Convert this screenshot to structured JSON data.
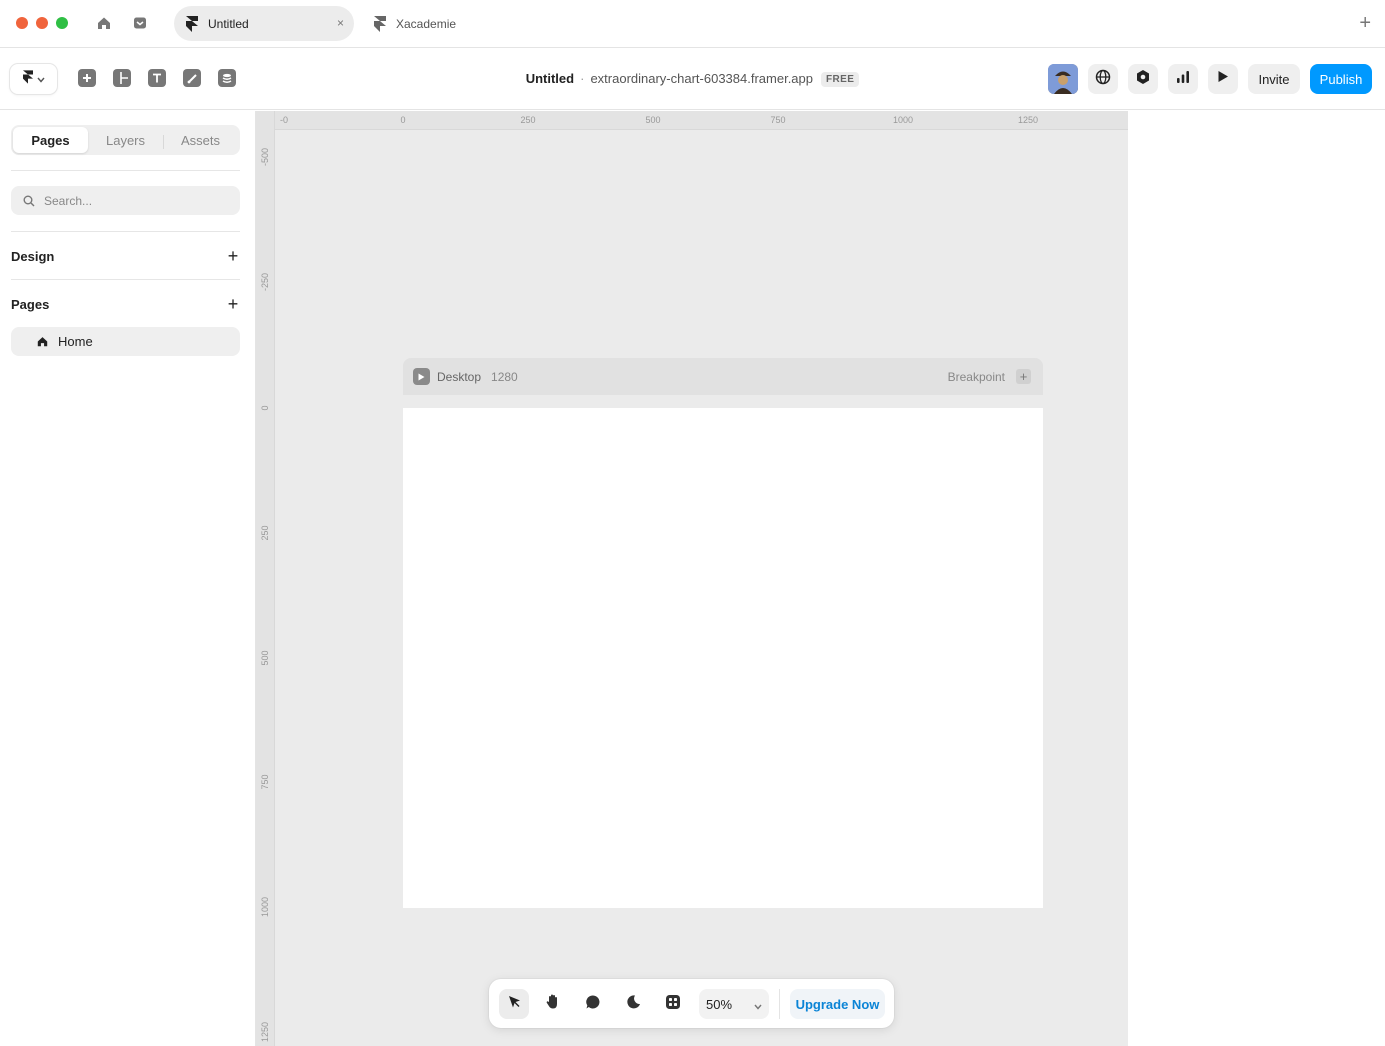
{
  "browser": {
    "tabs": [
      {
        "label": "Untitled",
        "close": "×"
      },
      {
        "label": "Xacademie"
      }
    ],
    "new_tab": "+"
  },
  "toolbar": {
    "project_name": "Untitled",
    "separator": "·",
    "project_url": "extraordinary-chart-603384.framer.app",
    "plan_badge": "FREE",
    "invite_label": "Invite",
    "publish_label": "Publish",
    "insert_tools": [
      "plus-square-icon",
      "layout-icon",
      "text-icon",
      "pen-icon",
      "database-icon"
    ]
  },
  "sidebar": {
    "tabs": [
      "Pages",
      "Layers",
      "Assets"
    ],
    "active_tab": "Pages",
    "search_placeholder": "Search...",
    "sections": [
      {
        "title": "Design",
        "add": "+"
      },
      {
        "title": "Pages",
        "add": "+"
      }
    ],
    "pages": [
      {
        "label": "Home",
        "icon": "home-icon"
      }
    ]
  },
  "canvas": {
    "ruler_top": [
      "-0",
      "0",
      "250",
      "500",
      "750",
      "1000",
      "1250"
    ],
    "ruler_left": [
      "-500",
      "-250",
      "0",
      "250",
      "500",
      "750",
      "1000",
      "1250"
    ],
    "frame": {
      "name": "Desktop",
      "width_label": "1280",
      "breakpoint_label": "Breakpoint",
      "breakpoint_add": "+"
    }
  },
  "dock": {
    "tools": [
      "cursor-icon",
      "hand-icon",
      "comment-icon",
      "moon-icon",
      "grid-icon"
    ],
    "zoom": "50%",
    "upgrade_label": "Upgrade Now"
  },
  "colors": {
    "accent": "#0099ff",
    "canvas_bg": "#ebebeb",
    "traffic_red": "#f0643c",
    "traffic_green": "#2fbf44"
  }
}
